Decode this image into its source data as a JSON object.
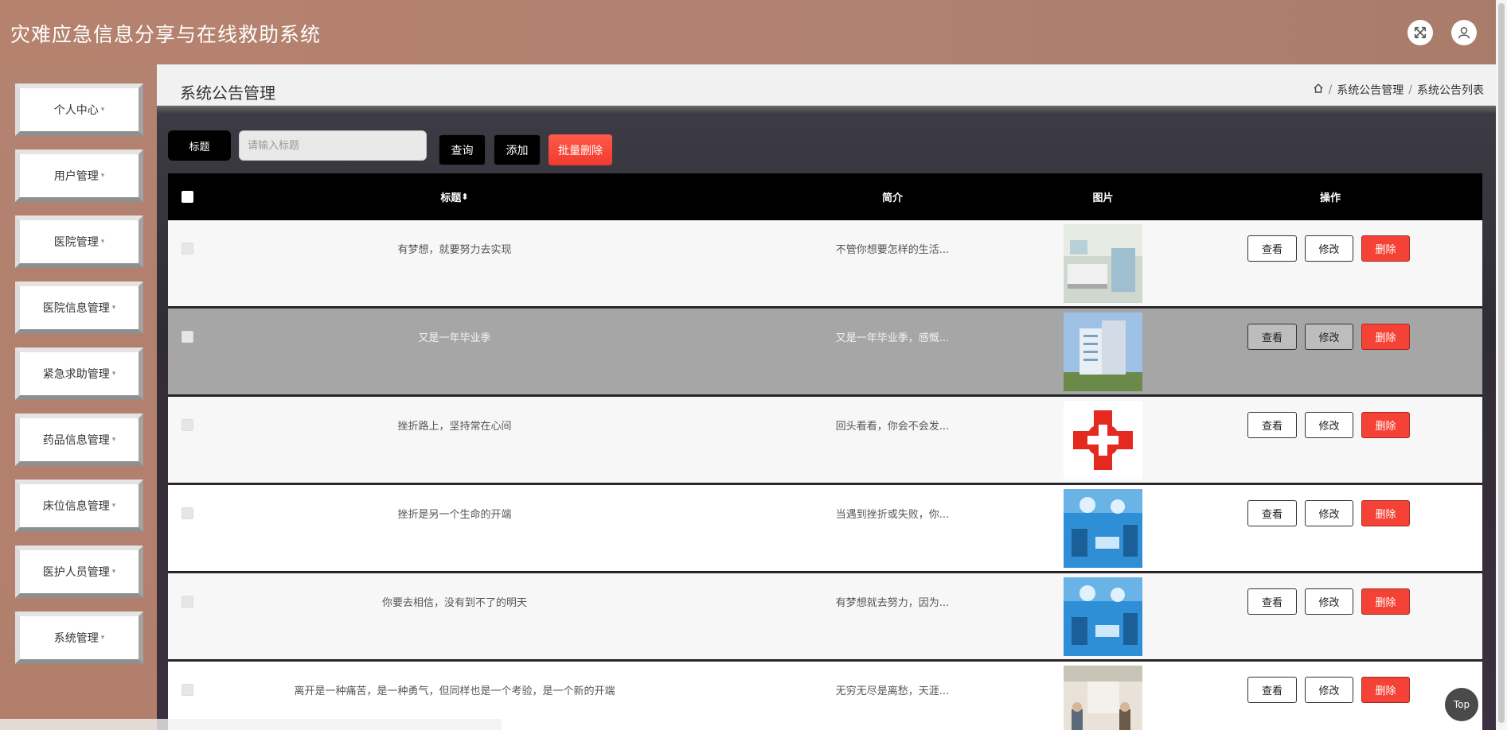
{
  "header": {
    "title": "灾难应急信息分享与在线救助系统"
  },
  "sidebar": {
    "items": [
      {
        "label": "个人中心"
      },
      {
        "label": "用户管理"
      },
      {
        "label": "医院管理"
      },
      {
        "label": "医院信息管理"
      },
      {
        "label": "紧急求助管理"
      },
      {
        "label": "药品信息管理"
      },
      {
        "label": "床位信息管理"
      },
      {
        "label": "医护人员管理"
      },
      {
        "label": "系统管理"
      }
    ]
  },
  "page": {
    "title": "系统公告管理",
    "breadcrumb": [
      "系统公告管理",
      "系统公告列表"
    ]
  },
  "filter": {
    "label": "标题",
    "placeholder": "请输入标题",
    "query_label": "查询",
    "add_label": "添加",
    "batch_delete_label": "批量删除"
  },
  "table": {
    "columns": {
      "title": "标题",
      "summary": "简介",
      "image": "图片",
      "actions": "操作"
    },
    "sort_icon": "⬍",
    "actions": {
      "view": "查看",
      "edit": "修改",
      "delete": "删除"
    },
    "rows": [
      {
        "title": "有梦想，就要努力去实现",
        "summary": "不管你想要怎样的生活...",
        "image": "hospital-ward"
      },
      {
        "title": "又是一年毕业季",
        "summary": "又是一年毕业季，感慨...",
        "image": "hospital-building"
      },
      {
        "title": "挫折路上，坚持常在心间",
        "summary": "回头看看，你会不会发...",
        "image": "red-cross"
      },
      {
        "title": "挫折是另一个生命的开端",
        "summary": "当遇到挫折或失败，你...",
        "image": "operating-room"
      },
      {
        "title": "你要去相信，没有到不了的明天",
        "summary": "有梦想就去努力，因为...",
        "image": "operating-room"
      },
      {
        "title": "离开是一种痛苦，是一种勇气，但同样也是一个考验，是一个新的开端",
        "summary": "无穷无尽是离愁，天涯...",
        "image": "hospital-hallway"
      }
    ]
  },
  "top_button": "Top",
  "colors": {
    "header": "#b5826d",
    "delete": "#f44336",
    "batch_delete": "#ff5a4a"
  }
}
